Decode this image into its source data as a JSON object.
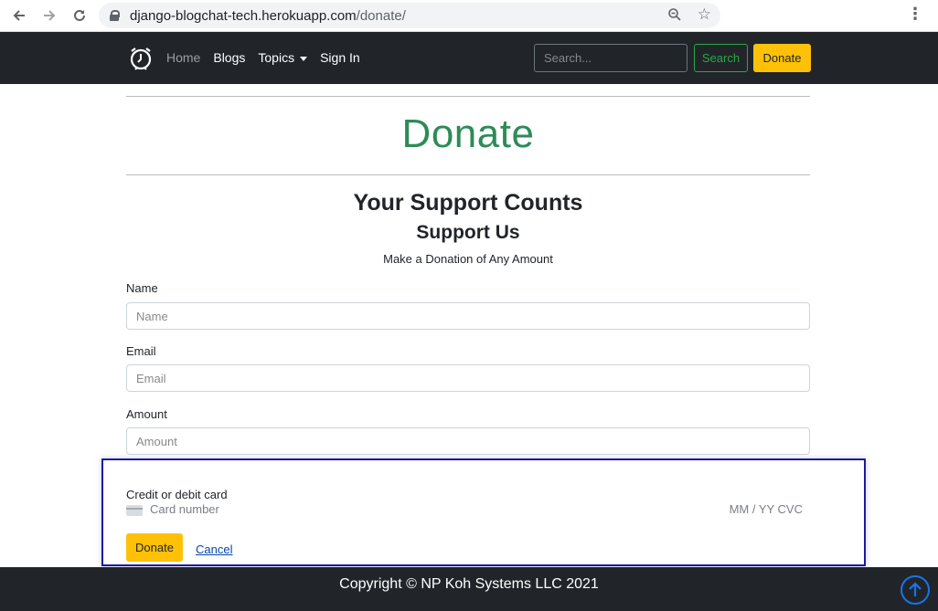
{
  "browser": {
    "url_host": "django-blogchat-tech.herokuapp.com",
    "url_path": "/donate/",
    "icons": [
      "back-arrow-icon",
      "forward-arrow-icon",
      "reload-icon",
      "lock-icon",
      "zoom-icon",
      "star-icon",
      "kebab-menu-icon"
    ]
  },
  "navbar": {
    "brand_icon": "alarm-clock-icon",
    "links": [
      "Home",
      "Blogs",
      "Topics",
      "Sign In"
    ],
    "search_placeholder": "Search...",
    "search_button": "Search",
    "donate_button": "Donate",
    "colors": {
      "bg": "#212529",
      "search_accent": "#28a745",
      "donate": "#ffc107"
    }
  },
  "page": {
    "title": "Donate",
    "heading": "Your Support Counts",
    "subheading": "Support Us",
    "subtext": "Make a Donation of Any Amount",
    "title_color": "#2e8b57"
  },
  "form": {
    "name_label": "Name",
    "name_placeholder": "Name",
    "email_label": "Email",
    "email_placeholder": "Email",
    "amount_label": "Amount",
    "amount_placeholder": "Amount",
    "card_label": "Credit or debit card",
    "card_number_placeholder": "Card number",
    "card_expiry_placeholder": "MM / YY  CVC",
    "card_icon": "credit-card-icon",
    "donate_button": "Donate",
    "cancel_link": "Cancel"
  },
  "footer": {
    "copyright": "Copyright © NP Koh Systems LLC 2021",
    "totop_icon": "arrow-up-circle-icon"
  }
}
